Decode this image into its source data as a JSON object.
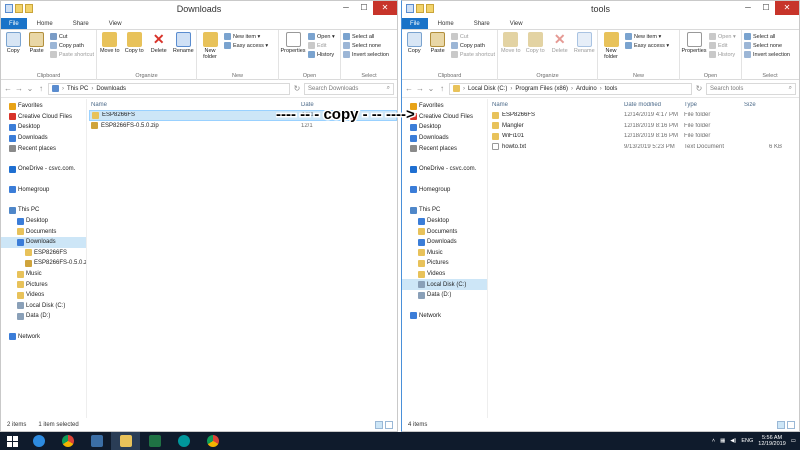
{
  "left": {
    "title": "Downloads",
    "tabs": [
      "File",
      "Home",
      "Share",
      "View"
    ],
    "ribbon": {
      "clipboard": {
        "copy": "Copy",
        "paste": "Paste",
        "cut": "Cut",
        "copy_path": "Copy path",
        "paste_shortcut": "Paste shortcut",
        "label": "Clipboard"
      },
      "organize": {
        "move_to": "Move to",
        "copy_to": "Copy to",
        "delete": "Delete",
        "rename": "Rename",
        "label": "Organize"
      },
      "new": {
        "new_folder": "New folder",
        "new_item": "New item ▾",
        "easy_access": "Easy access ▾",
        "label": "New"
      },
      "open": {
        "properties": "Properties",
        "open": "Open ▾",
        "edit": "Edit",
        "history": "History",
        "label": "Open"
      },
      "select": {
        "select_all": "Select all",
        "select_none": "Select none",
        "invert": "Invert selection",
        "label": "Select"
      }
    },
    "breadcrumb": [
      "This PC",
      "Downloads"
    ],
    "search_placeholder": "Search Downloads",
    "nav": [
      {
        "label": "Favorites",
        "kind": "star"
      },
      {
        "label": "Creative Cloud Files",
        "kind": "cloud"
      },
      {
        "label": "Desktop",
        "kind": "desktop"
      },
      {
        "label": "Downloads",
        "kind": "folder-dl"
      },
      {
        "label": "Recent places",
        "kind": "recent"
      },
      {
        "gap": true
      },
      {
        "label": "OneDrive - csvc.com.",
        "kind": "onedrive"
      },
      {
        "gap": true
      },
      {
        "label": "Homegroup",
        "kind": "homegroup"
      },
      {
        "gap": true
      },
      {
        "label": "This PC",
        "kind": "pc"
      },
      {
        "label": "Desktop",
        "kind": "desktop",
        "indent": 1
      },
      {
        "label": "Documents",
        "kind": "folder",
        "indent": 1
      },
      {
        "label": "Downloads",
        "kind": "folder-dl",
        "indent": 1,
        "selected": true
      },
      {
        "label": "ESP8266FS",
        "kind": "folder",
        "indent": 2
      },
      {
        "label": "ESP8266FS-0.5.0.zi",
        "kind": "zip",
        "indent": 2
      },
      {
        "label": "Music",
        "kind": "folder",
        "indent": 1
      },
      {
        "label": "Pictures",
        "kind": "folder",
        "indent": 1
      },
      {
        "label": "Videos",
        "kind": "folder",
        "indent": 1
      },
      {
        "label": "Local Disk (C:)",
        "kind": "disk",
        "indent": 1
      },
      {
        "label": "Data (D:)",
        "kind": "disk",
        "indent": 1
      },
      {
        "gap": true
      },
      {
        "label": "Network",
        "kind": "network"
      }
    ],
    "columns": [
      "Name",
      "Date"
    ],
    "files": [
      {
        "name": "ESP8266FS",
        "date": "12/1",
        "kind": "folder",
        "selected": true
      },
      {
        "name": "ESP8266FS-0.5.0.zip",
        "date": "12/1",
        "kind": "zip"
      }
    ],
    "status": {
      "count": "2 items",
      "selected": "1 item selected"
    }
  },
  "right": {
    "title": "tools",
    "tabs": [
      "File",
      "Home",
      "Share",
      "View"
    ],
    "breadcrumb": [
      "Local Disk (C:)",
      "Program Files (x86)",
      "Arduino",
      "tools"
    ],
    "search_placeholder": "Search tools",
    "nav": [
      {
        "label": "Favorites",
        "kind": "star"
      },
      {
        "label": "Creative Cloud Files",
        "kind": "cloud"
      },
      {
        "label": "Desktop",
        "kind": "desktop"
      },
      {
        "label": "Downloads",
        "kind": "folder-dl"
      },
      {
        "label": "Recent places",
        "kind": "recent"
      },
      {
        "gap": true
      },
      {
        "label": "OneDrive - csvc.com.",
        "kind": "onedrive"
      },
      {
        "gap": true
      },
      {
        "label": "Homegroup",
        "kind": "homegroup"
      },
      {
        "gap": true
      },
      {
        "label": "This PC",
        "kind": "pc"
      },
      {
        "label": "Desktop",
        "kind": "desktop",
        "indent": 1
      },
      {
        "label": "Documents",
        "kind": "folder",
        "indent": 1
      },
      {
        "label": "Downloads",
        "kind": "folder-dl",
        "indent": 1
      },
      {
        "label": "Music",
        "kind": "folder",
        "indent": 1
      },
      {
        "label": "Pictures",
        "kind": "folder",
        "indent": 1
      },
      {
        "label": "Videos",
        "kind": "folder",
        "indent": 1
      },
      {
        "label": "Local Disk (C:)",
        "kind": "disk",
        "indent": 1,
        "selected": true
      },
      {
        "label": "Data (D:)",
        "kind": "disk",
        "indent": 1
      },
      {
        "gap": true
      },
      {
        "label": "Network",
        "kind": "network"
      }
    ],
    "columns": [
      "Name",
      "Date modified",
      "Type",
      "Size"
    ],
    "files": [
      {
        "name": "ESP8266FS",
        "date": "12/14/2019 4:17 PM",
        "type": "File folder",
        "size": "",
        "kind": "folder"
      },
      {
        "name": "Mangler",
        "date": "12/18/2019 8:16 PM",
        "type": "File folder",
        "size": "",
        "kind": "folder"
      },
      {
        "name": "WiFi101",
        "date": "12/18/2019 8:16 PM",
        "type": "File folder",
        "size": "",
        "kind": "folder"
      },
      {
        "name": "howto.txt",
        "date": "9/13/2019 5:23 PM",
        "type": "Text Document",
        "size": "6 KB",
        "kind": "txt"
      }
    ],
    "status": {
      "count": "4 items",
      "selected": ""
    }
  },
  "annotation": {
    "text": "---- -- - copy - -- ---->",
    "color": "#000000"
  },
  "taskbar": {
    "apps": [
      "start",
      "ie",
      "chrome",
      "taskview",
      "explorer",
      "excel",
      "arduino",
      "chrome2"
    ],
    "lang": "ENG",
    "time": "5:56 AM",
    "date": "12/19/2019"
  },
  "colors": {
    "accent": "#1a73c8",
    "selection": "#cde6f7",
    "folder": "#e8c25a",
    "taskbar": "#0f1b2c"
  }
}
